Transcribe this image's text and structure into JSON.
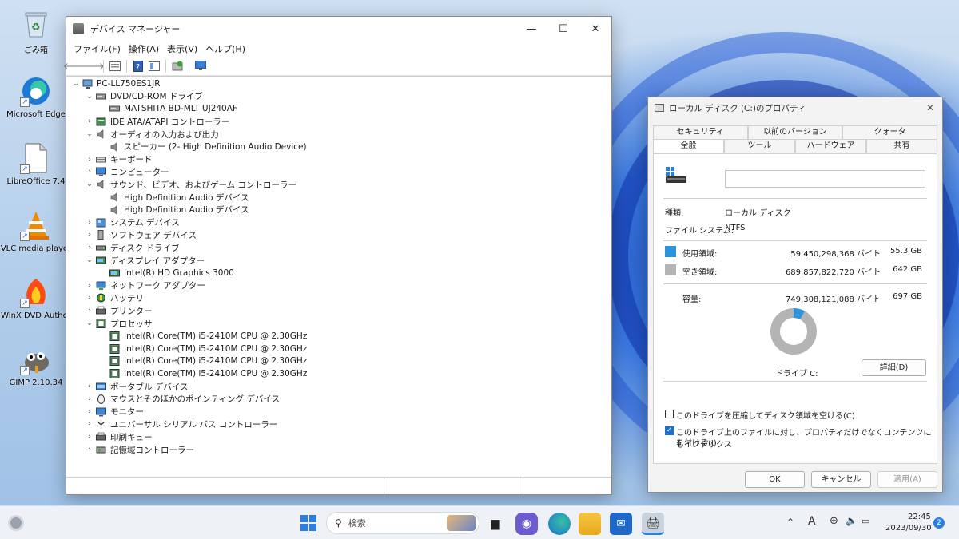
{
  "desktop": {
    "icons": [
      {
        "label": "ごみ箱",
        "icon": "recycle-bin-icon"
      },
      {
        "label": "Microsoft Edge",
        "icon": "edge-icon"
      },
      {
        "label": "LibreOffice 7.4",
        "icon": "libreoffice-icon"
      },
      {
        "label": "VLC media player",
        "icon": "vlc-icon"
      },
      {
        "label": "WinX DVD Author",
        "icon": "winx-dvd-icon"
      },
      {
        "label": "GIMP 2.10.34",
        "icon": "gimp-icon"
      }
    ]
  },
  "devmgr": {
    "title": "デバイス マネージャー",
    "menu": [
      "ファイル(F)",
      "操作(A)",
      "表示(V)",
      "ヘルプ(H)"
    ],
    "tree": [
      {
        "label": "PC-LL750ES1JR",
        "level": 0,
        "expanded": true,
        "icon": "computer"
      },
      {
        "label": "DVD/CD-ROM ドライブ",
        "level": 1,
        "expanded": true,
        "icon": "dvd"
      },
      {
        "label": "MATSHITA BD-MLT UJ240AF",
        "level": 2,
        "icon": "dvd"
      },
      {
        "label": "IDE ATA/ATAPI コントローラー",
        "level": 1,
        "expanded": false,
        "icon": "ide"
      },
      {
        "label": "オーディオの入力および出力",
        "level": 1,
        "expanded": true,
        "icon": "audio"
      },
      {
        "label": "スピーカー (2- High Definition Audio Device)",
        "level": 2,
        "icon": "audio"
      },
      {
        "label": "キーボード",
        "level": 1,
        "expanded": false,
        "icon": "keyboard"
      },
      {
        "label": "コンピューター",
        "level": 1,
        "expanded": false,
        "icon": "monitor"
      },
      {
        "label": "サウンド、ビデオ、およびゲーム コントローラー",
        "level": 1,
        "expanded": true,
        "icon": "audio"
      },
      {
        "label": "High Definition Audio デバイス",
        "level": 2,
        "icon": "audio"
      },
      {
        "label": "High Definition Audio デバイス",
        "level": 2,
        "icon": "audio"
      },
      {
        "label": "システム デバイス",
        "level": 1,
        "expanded": false,
        "icon": "system"
      },
      {
        "label": "ソフトウェア デバイス",
        "level": 1,
        "expanded": false,
        "icon": "software"
      },
      {
        "label": "ディスク ドライブ",
        "level": 1,
        "expanded": false,
        "icon": "disk"
      },
      {
        "label": "ディスプレイ アダプター",
        "level": 1,
        "expanded": true,
        "icon": "display"
      },
      {
        "label": "Intel(R) HD Graphics 3000",
        "level": 2,
        "icon": "display"
      },
      {
        "label": "ネットワーク アダプター",
        "level": 1,
        "expanded": false,
        "icon": "network"
      },
      {
        "label": "バッテリ",
        "level": 1,
        "expanded": false,
        "icon": "battery"
      },
      {
        "label": "プリンター",
        "level": 1,
        "expanded": false,
        "icon": "printer"
      },
      {
        "label": "プロセッサ",
        "level": 1,
        "expanded": true,
        "icon": "cpu"
      },
      {
        "label": "Intel(R) Core(TM) i5-2410M CPU @ 2.30GHz",
        "level": 2,
        "icon": "cpu"
      },
      {
        "label": "Intel(R) Core(TM) i5-2410M CPU @ 2.30GHz",
        "level": 2,
        "icon": "cpu"
      },
      {
        "label": "Intel(R) Core(TM) i5-2410M CPU @ 2.30GHz",
        "level": 2,
        "icon": "cpu"
      },
      {
        "label": "Intel(R) Core(TM) i5-2410M CPU @ 2.30GHz",
        "level": 2,
        "icon": "cpu"
      },
      {
        "label": "ポータブル デバイス",
        "level": 1,
        "expanded": false,
        "icon": "portable"
      },
      {
        "label": "マウスとそのほかのポインティング デバイス",
        "level": 1,
        "expanded": false,
        "icon": "mouse"
      },
      {
        "label": "モニター",
        "level": 1,
        "expanded": false,
        "icon": "monitor"
      },
      {
        "label": "ユニバーサル シリアル バス コントローラー",
        "level": 1,
        "expanded": false,
        "icon": "usb"
      },
      {
        "label": "印刷キュー",
        "level": 1,
        "expanded": false,
        "icon": "printer"
      },
      {
        "label": "記憶域コントローラー",
        "level": 1,
        "expanded": false,
        "icon": "storage"
      }
    ]
  },
  "props": {
    "title": "ローカル ディスク (C:)のプロパティ",
    "tabs_row1": [
      "セキュリティ",
      "以前のバージョン",
      "クォータ"
    ],
    "tabs_row2": [
      "全般",
      "ツール",
      "ハードウェア",
      "共有"
    ],
    "volume_name": "",
    "type_label": "種類:",
    "type_value": "ローカル ディスク",
    "fs_label": "ファイル システム:",
    "fs_value": "NTFS",
    "used_label": "使用領域:",
    "used_bytes": "59,450,298,368 バイト",
    "used_size": "55.3 GB",
    "free_label": "空き領域:",
    "free_bytes": "689,857,822,720 バイト",
    "free_size": "642 GB",
    "cap_label": "容量:",
    "cap_bytes": "749,308,121,088 バイト",
    "cap_size": "697 GB",
    "used_fraction": 0.0793,
    "drive_label": "ドライブ C:",
    "detail_button": "詳細(D)",
    "compress_label": "このドライブを圧縮してディスク領域を空ける(C)",
    "compress_checked": false,
    "index_label_1": "このドライブ上のファイルに対し、プロパティだけでなくコンテンツにもインデックス",
    "index_label_2": "を付ける(I)",
    "index_checked": true,
    "ok": "OK",
    "cancel": "キャンセル",
    "apply": "適用(A)",
    "colors": {
      "used": "#2a95dd",
      "free": "#b4b4b4"
    }
  },
  "taskbar": {
    "search_placeholder": "検索",
    "time": "22:45",
    "date": "2023/09/30",
    "ime": "A",
    "notifications": "2"
  }
}
